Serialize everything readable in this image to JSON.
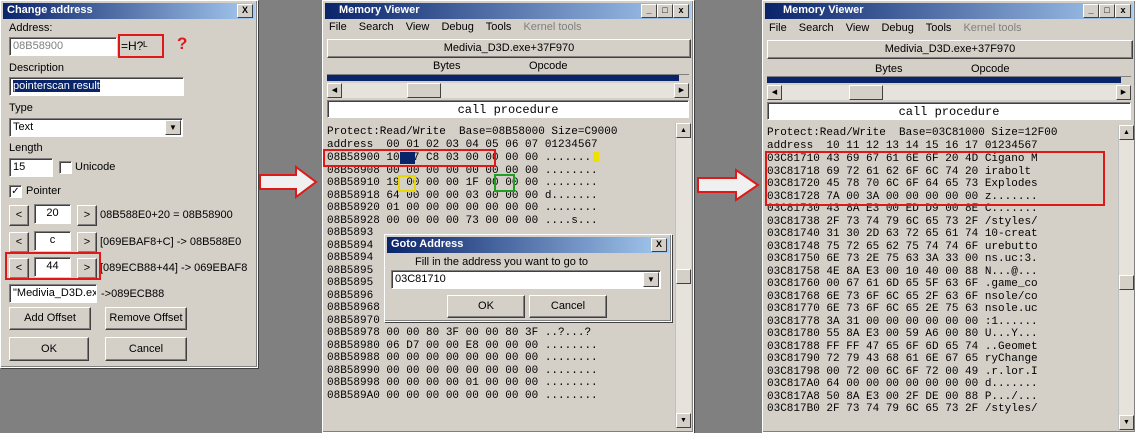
{
  "change_address": {
    "title": "Change address",
    "close": "X",
    "address_label": "Address:",
    "address_value": "08B58900",
    "address_result": "=H?ᴸ",
    "question_mark": "?",
    "description_label": "Description",
    "description_value": "pointerscan result",
    "type_label": "Type",
    "type_value": "Text",
    "length_label": "Length",
    "length_value": "15",
    "unicode_label": "Unicode",
    "pointer_label": "Pointer",
    "offsets": [
      {
        "value": "20",
        "result": "08B588E0+20 = 08B58900"
      },
      {
        "value": "c",
        "result": "[069EBAF8+C] -> 08B588E0"
      },
      {
        "value": "44",
        "result": "[089ECB88+44] -> 069EBAF8"
      }
    ],
    "base_value": "\"Medivia_D3D.ex",
    "base_result": "->089ECB88",
    "add_offset": "Add Offset",
    "remove_offset": "Remove Offset",
    "ok": "OK",
    "cancel": "Cancel",
    "lt": "<",
    "gt": ">"
  },
  "mv1": {
    "title": "Memory Viewer",
    "menu": [
      "File",
      "Search",
      "View",
      "Debug",
      "Tools",
      "Kernel tools"
    ],
    "module": "Medivia_D3D.exe+37F970",
    "col_bytes": "Bytes",
    "col_opcode": "Opcode",
    "instruction": "call procedure",
    "protect": "Protect:Read/Write  Base=08B58000 Size=C9000",
    "header": "address  00 01 02 03 04 05 06 07 01234567",
    "rows": [
      "08B58900 10 17 C8 03 00 00 00 00 .......",
      "08B58908 00 00 00 00 00 00 00 00 ........",
      "08B58910 19 00 00 00 1F 00 00 00 ........",
      "08B58918 64 00 00 00 03 00 00 00 d.......",
      "08B58920 01 00 00 00 00 00 00 00 ........",
      "08B58928 00 00 00 00 73 00 00 00 ....s...",
      "08B5893",
      "08B5894",
      "08B5894",
      "08B5895",
      "08B5895",
      "08B5896",
      "08B58968 00 00 80 3F 00 00 80 3F ..?...?",
      "08B58970 00 00 80 3F 00 00 80 3F ..?...?",
      "08B58978 00 00 80 3F 00 00 80 3F ..?...?",
      "08B58980 06 D7 00 00 E8 00 00 00 ........",
      "08B58988 00 00 00 00 00 00 00 00 ........",
      "08B58990 00 00 00 00 00 00 00 00 ........",
      "08B58998 00 00 00 00 01 00 00 00 ........",
      "08B589A0 00 00 00 00 00 00 00 00 ........"
    ]
  },
  "goto": {
    "title": "Goto Address",
    "close": "X",
    "prompt": "Fill in the address you want to go to",
    "value": "03C81710",
    "ok": "OK",
    "cancel": "Cancel"
  },
  "mv2": {
    "title": "Memory Viewer",
    "menu": [
      "File",
      "Search",
      "View",
      "Debug",
      "Tools",
      "Kernel tools"
    ],
    "module": "Medivia_D3D.exe+37F970",
    "col_bytes": "Bytes",
    "col_opcode": "Opcode",
    "instruction": "call procedure",
    "protect": "Protect:Read/Write  Base=03C81000 Size=12F00",
    "header": "address  10 11 12 13 14 15 16 17 01234567",
    "rows": [
      "03C81710 43 69 67 61 6E 6F 20 4D Cigano M",
      "03C81718 69 72 61 62 6F 6C 74 20 irabolt ",
      "03C81720 45 78 70 6C 6F 64 65 73 Explodes",
      "03C81728 7A 00 3A 00 00 00 00 00 z.......",
      "03C81730 43 8A E3 00 ED D9 00 8E C.......",
      "03C81738 2F 73 74 79 6C 65 73 2F /styles/",
      "03C81740 31 30 2D 63 72 65 61 74 10-creat",
      "03C81748 75 72 65 62 75 74 74 6F urebutto",
      "03C81750 6E 73 2E 75 63 3A 33 00 ns.uc:3.",
      "03C81758 4E 8A E3 00 10 40 00 88 N...@...",
      "03C81760 00 67 61 6D 65 5F 63 6F .game_co",
      "03C81768 6E 73 6F 6C 65 2F 63 6F nsole/co",
      "03C81770 6E 73 6F 6C 65 2E 75 63 nsole.uc",
      "03C81778 3A 31 00 00 00 00 00 00 :1......",
      "03C81780 55 8A E3 00 59 A6 00 80 U...Y...",
      "03C81788 FF FF 47 65 6F 6D 65 74 ..Geomet",
      "03C81790 72 79 43 68 61 6E 67 65 ryChange",
      "03C81798 00 72 00 6C 6F 72 00 49 .r.lor.I",
      "03C817A0 64 00 00 00 00 00 00 00 d.......",
      "03C817A8 50 8A E3 00 2F DE 00 88 P.../...",
      "03C817B0 2F 73 74 79 6C 65 73 2F /styles/"
    ]
  }
}
